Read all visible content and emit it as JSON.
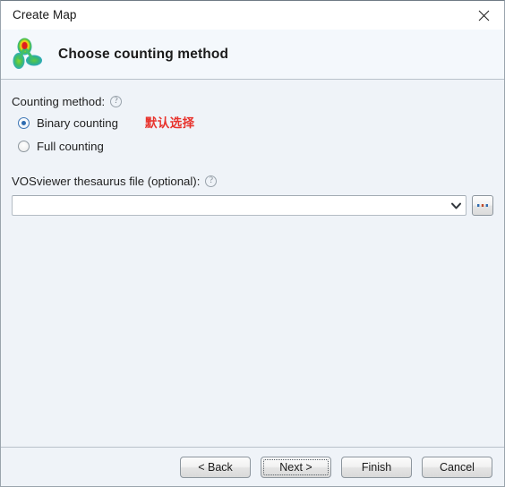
{
  "window": {
    "title": "Create Map",
    "close_icon": "close-icon"
  },
  "banner": {
    "icon": "vosviewer-cluster-icon",
    "heading": "Choose counting method"
  },
  "counting_method": {
    "label": "Counting method:",
    "help_icon": "?",
    "options": [
      {
        "label": "Binary counting",
        "selected": true
      },
      {
        "label": "Full counting",
        "selected": false
      }
    ],
    "annotation": "默认选择",
    "annotation_color": "#e8322c"
  },
  "thesaurus": {
    "label": "VOSviewer thesaurus file (optional):",
    "help_icon": "?",
    "value": "",
    "placeholder": "",
    "dropdown_icon": "chevron-down-icon",
    "browse_label": "...",
    "browse_icon": "ellipsis-icon"
  },
  "footer": {
    "buttons": [
      {
        "label": "< Back",
        "focused": false
      },
      {
        "label": "Next >",
        "focused": true
      },
      {
        "label": "Finish",
        "focused": false
      },
      {
        "label": "Cancel",
        "focused": false
      }
    ]
  },
  "colors": {
    "body_bg": "#eff3f8",
    "banner_bg": "#f4f8fc",
    "titlebar_bg": "#ffffff",
    "accent": "#2f6cb0",
    "annotation": "#e8322c"
  }
}
